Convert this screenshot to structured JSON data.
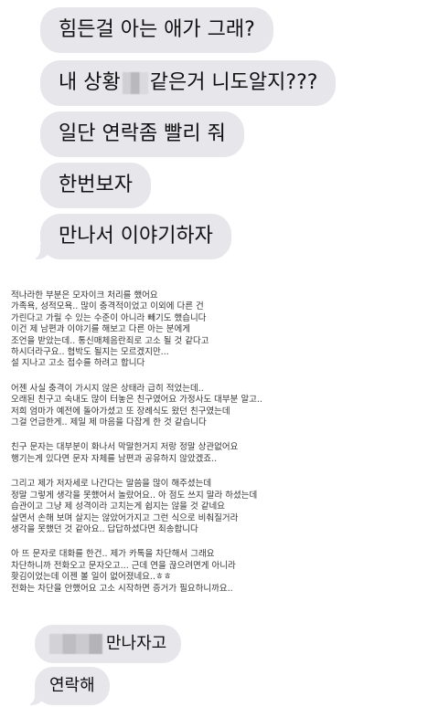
{
  "messages_top": [
    {
      "text": "힘든걸 아는 애가 그래?"
    },
    {
      "pre": "내 상황",
      "post": "같은거 니도알지???"
    },
    {
      "text": "일단 연락좀 빨리 줘"
    },
    {
      "text": "한번보자"
    },
    {
      "text": "만나서 이야기하자"
    }
  ],
  "body_paragraphs": [
    [
      "적나라한 부분은 모자이크 처리를 했어요",
      "가족욕, 성적모욕.. 많이 충격적이었고 이외에 다른 건",
      "가린다고 가릴 수 있는 수준이 아니라 빼기도 했습니다",
      "이건 제 남편과 이야기를 해보고 다른 아는 분에게",
      "조언을 받았는데.. 통신매체음란죄로 고소 될 것 같다고",
      "하시더라구요.. 협박도 될지는 모르겠지만...",
      "설 지나고 고소 접수를 하려고 합니다"
    ],
    [
      "어젠 사실 충격이 가시지 않은 상태라 급히 적었는데..",
      "오래된 친구고 숙내도 많이 터놓은 친구였어요 가정사도 대부분 알고..",
      "저희 엄마가 예전에 돌아가셨고 또 장례식도 왔던 친구였는데",
      "그걸 언급한게.. 제일 제 마음을 다잡게 한 것 같습니다"
    ],
    [
      "친구 문자는 대부분이 화나서 막말한거지 저랑 정말 상관없어요",
      "행기는게 있다면 문자 자체를 남편과 공유하지 않았겠죠.."
    ],
    [
      "그리고 제가 저자세로 나간다는 말씀을 많이 해주셨는데",
      "정말 그렇게 생각을 못했어서 놀랐어요.. 아 점도 쓰지 말라 하셨는데",
      "습관이고 그냥 제 성격이라 고치는게 쉽지는 않을 것 같네요",
      "살면서 손해 보며 살지는 않았어가지고 그런 식으로 비춰질거라",
      "생각을 못했던 것 같아요.. 답답하셨다면 죄송합니다"
    ],
    [
      "아 뜨 문자로 대화를 한건.. 제가 카톡을 차단해서 그래요",
      "차단하니까 전화오고 문자오고... 근데 연을 끊으려면게 아니라",
      "홧김이었는데 이젠 볼 일이 없어졌네요..ㅎㅎ",
      "전화는 차단을 안했어요 고소 시작하면 증거가 필요하니까요.."
    ]
  ],
  "messages_bottom": [
    {
      "post": "만나자고"
    },
    {
      "text": "연락해"
    }
  ],
  "colors": {
    "bubble": "#e6e6eb",
    "text": "#111111",
    "body_text": "#333333"
  }
}
